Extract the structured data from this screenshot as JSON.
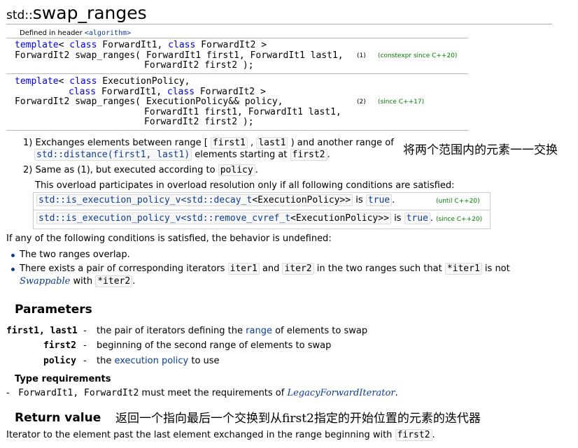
{
  "title": {
    "ns": "std::",
    "name": "swap_ranges"
  },
  "defined_in": {
    "prefix": "Defined in header ",
    "header": "<algorithm>"
  },
  "decl1": {
    "l1_kw1": "template",
    "l1_mid1": "< ",
    "l1_kw2": "class",
    "l1_mid2": " ForwardIt1, ",
    "l1_kw3": "class",
    "l1_end": " ForwardIt2 >",
    "l2": "ForwardIt2 swap_ranges( ForwardIt1 first1, ForwardIt1 last1,",
    "l3": "ForwardIt2 first2 );",
    "num": "(1)",
    "note": "(constexpr since C++20)"
  },
  "decl2": {
    "l1_kw1": "template",
    "l1_mid1": "< ",
    "l1_kw2": "class",
    "l1_end": " ExecutionPolicy,",
    "l2_kw": "class",
    "l2_mid": " ForwardIt1, ",
    "l2_kw2": "class",
    "l2_end": " ForwardIt2 >",
    "l3": "ForwardIt2 swap_ranges( ExecutionPolicy&& policy,",
    "l4": "ForwardIt1 first1, ForwardIt1 last1,",
    "l5": "ForwardIt2 first2 );",
    "num": "(2)",
    "note": "(since C++17)"
  },
  "desc1": {
    "num": "1)",
    "t1": "Exchanges elements between range [",
    "c1": "first1",
    "t2": ",",
    "c2": "last1",
    "t3": ") and another range of",
    "c3": "std::distance(first1, last1)",
    "t4": "elements starting at",
    "c4": "first2",
    "t5": "."
  },
  "annotation1": "将两个范围内的元素一一交换",
  "desc2": {
    "num": "2)",
    "t1": "Same as (1), but executed according to",
    "c1": "policy",
    "t2": "."
  },
  "overload_note": "This overload participates in overload resolution only if all following conditions are satisfied:",
  "conditions": [
    {
      "code1": "std::is_execution_policy_v<std::decay_t",
      "code2": "<ExecutionPolicy>>",
      "is": "is",
      "val": "true",
      "dot": ".",
      "note": "(until C++20)"
    },
    {
      "code1": "std::is_execution_policy_v<std::remove_cvref_t",
      "code2": "<ExecutionPolicy>>",
      "is": "is",
      "val": "true",
      "dot": ".",
      "note": "(since C++20)"
    }
  ],
  "undefined_intro": "If any of the following conditions is satisfied, the behavior is undefined:",
  "bullets": {
    "b1": "The two ranges overlap.",
    "b2_t1": "There exists a pair of corresponding iterators",
    "b2_c1": "iter1",
    "b2_t2": "and",
    "b2_c2": "iter2",
    "b2_t3": "in the two ranges such that",
    "b2_c3": "*iter1",
    "b2_t4": "is not",
    "b2_link": "Swappable",
    "b2_t5": "with",
    "b2_c4": "*iter2",
    "b2_t6": "."
  },
  "params_heading": "Parameters",
  "params": [
    {
      "name": "first1, last1",
      "dash": "-",
      "t1": "the pair of iterators defining the ",
      "link": "range",
      "t2": " of elements to swap"
    },
    {
      "name": "first2",
      "dash": "-",
      "t1": "beginning of the second range of elements to swap",
      "link": "",
      "t2": ""
    },
    {
      "name": "policy",
      "dash": "-",
      "t1": "the ",
      "link": "execution policy",
      "t2": " to use"
    }
  ],
  "type_req_heading": "Type requirements",
  "type_req": {
    "dash": "-",
    "code": "ForwardIt1, ForwardIt2",
    "t1": " must meet the requirements of ",
    "link": "LegacyForwardIterator",
    "t2": "."
  },
  "return_heading": "Return value",
  "annotation2": "返回一个指向最后一个交换到从first2指定的开始位置的元素的迭代器",
  "return_text": {
    "t1": "Iterator to the element past the last element exchanged in the range beginning with",
    "c1": "first2",
    "t2": "."
  }
}
